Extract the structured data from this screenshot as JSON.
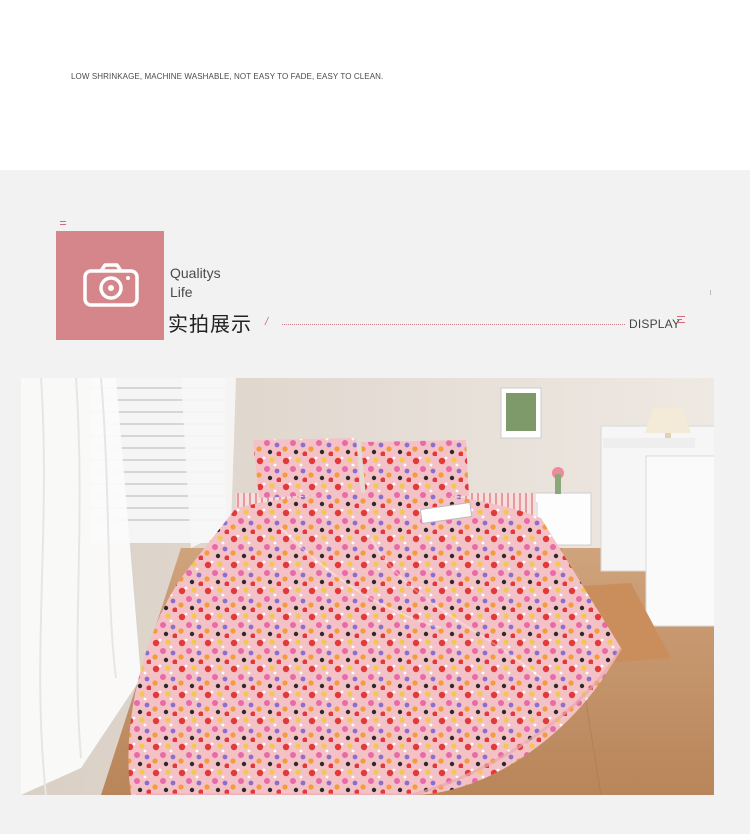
{
  "top_note": "LOW SHRINKAGE, MACHINE WASHABLE, NOT EASY TO FADE, EASY TO CLEAN.",
  "section": {
    "title_en_line1": "Qualitys",
    "title_en_line2": "Life",
    "title_cn": "实拍展示",
    "slash": "/",
    "display_label": "DISPLAY"
  },
  "colors": {
    "accent_pink": "#d4868a",
    "accent_line": "#d46a7e",
    "band_gray": "#f2f2f2"
  },
  "icons": {
    "camera": "camera-icon"
  },
  "photo": {
    "label": "bedroom photo with floral bedding"
  }
}
